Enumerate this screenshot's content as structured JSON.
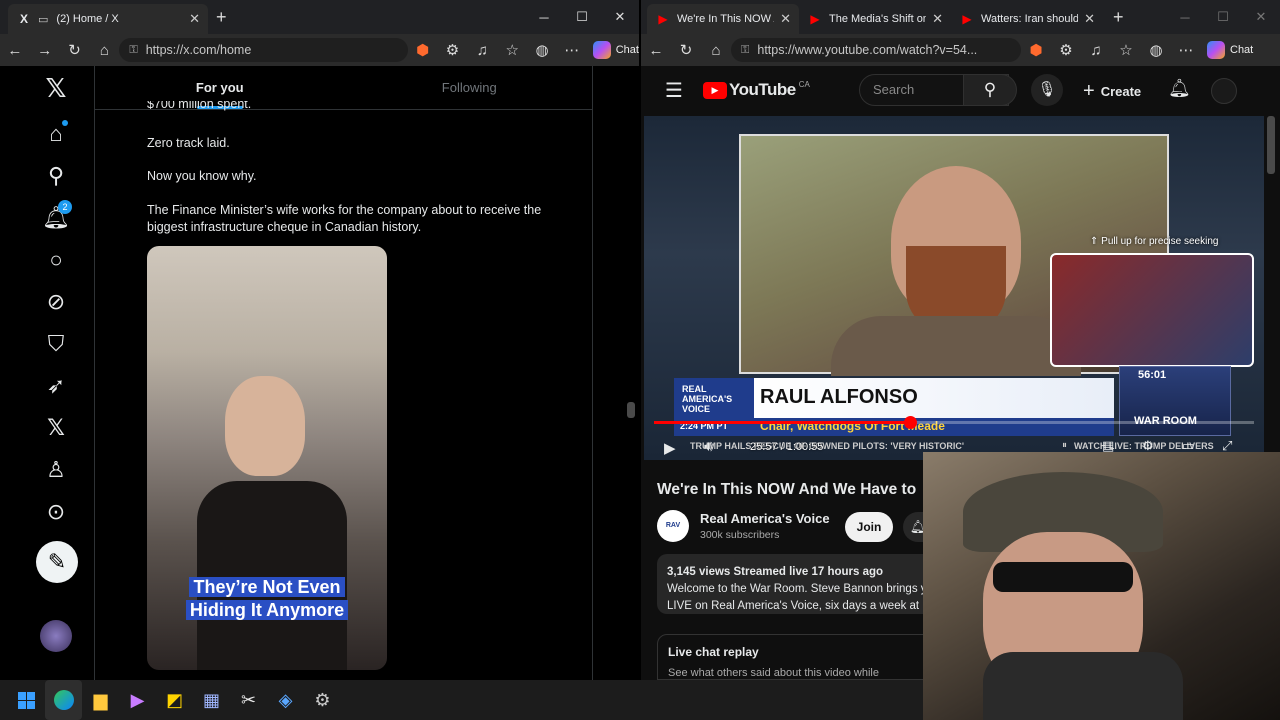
{
  "left_window": {
    "tab": {
      "title": "(2) Home / X",
      "favicon": "X"
    },
    "url": "https://x.com/home",
    "chat_label": "Chat",
    "x_tabs": [
      "For you",
      "Following"
    ],
    "notification_badge": "2",
    "post": {
      "line0": "$700 million spent.",
      "line1": "Zero track laid.",
      "line2": "Now you know why.",
      "line3": "The Finance Minister’s wife works for the company about to receive the biggest infrastructure cheque in Canadian history.",
      "caption_line1": "They’re Not Even",
      "caption_line2": "Hiding It Anymore"
    },
    "nav_icons": [
      "x-logo",
      "home-icon",
      "search-icon",
      "notifications-icon",
      "messages-icon",
      "grok-icon",
      "bookmarks-icon",
      "rocket-icon",
      "premium-x-icon",
      "profile-icon",
      "more-icon",
      "compose-post-icon",
      "account-avatar-icon"
    ]
  },
  "right_window": {
    "tabs": [
      {
        "title": "We're In This NOW And",
        "active": true
      },
      {
        "title": "The Media's Shift on Ir",
        "active": false
      },
      {
        "title": "Watters: Iran should NO",
        "active": false
      }
    ],
    "url": "https://www.youtube.com/watch?v=54...",
    "chat_label": "Chat",
    "youtube": {
      "logo_text": "YouTube",
      "country": "CA",
      "search_placeholder": "Search",
      "create_label": "Create",
      "seek_hint": "Pull up for precise seeking",
      "seek_time": "56:01",
      "lower_third_brand": "REAL AMERICA'S VOICE",
      "lower_third_name": "RAUL ALFONSO",
      "lower_third_title": "Chair, Watchdogs Of Fort Meade",
      "lower_third_time": "2:24 PM PT",
      "ticker": "TRUMP HAILS RESCUE OF DOWNED PILOTS: 'VERY HISTORIC'",
      "ticker2": "WATCH LIVE: TRUMP DELIVERS",
      "war_room": "WAR ROOM",
      "time_display": "25:57 / 1:00:55",
      "progress": 0.426,
      "video_title": "We're In This NOW And We Have to",
      "channel_name": "Real America's Voice",
      "subscribers": "300k subscribers",
      "join_label": "Join",
      "stats": "3,145 views  Streamed live 17 hours ago",
      "desc1": "Welcome to the War Room. Steve Bannon brings y",
      "desc2": "LIVE on Real America's Voice, six days a week at 1",
      "live_chat": "Live chat replay",
      "live_chat_sub": "See what others said about this video while"
    }
  },
  "colors": {
    "x_accent": "#1d9bf0",
    "yt_red": "#ff0000",
    "rav_blue": "#1f3c8c"
  },
  "taskbar_icons": [
    "windows-start-icon",
    "edge-icon",
    "file-explorer-icon",
    "media-player-icon",
    "sticky-notes-icon",
    "calculator-icon",
    "snipping-tool-icon",
    "paint-icon",
    "settings-icon"
  ]
}
